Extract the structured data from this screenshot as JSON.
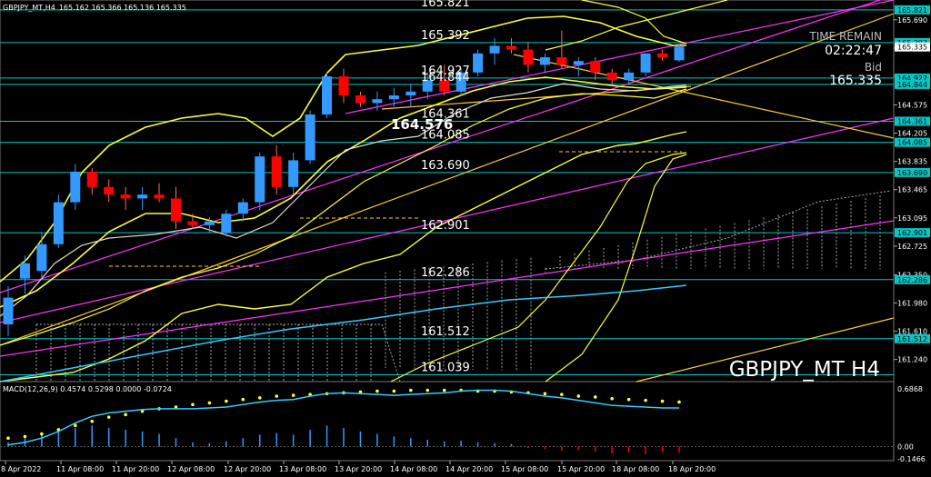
{
  "header": {
    "symbol_info": "GBPJPY_MT,H4",
    "ohlc": "165.162 165.366 165.136 165.335"
  },
  "info_panel": {
    "time_remain_label": "TIME REMAIN",
    "time_remain_value": "02:22:47",
    "bid_label": "Bid",
    "bid_value": "165.335"
  },
  "watermark": "GBPJPY_MT H4",
  "macd_label": "MACD(12,26,9) 0.4574 0.5298 0.0000 -0.0724",
  "price_badge": "164.576",
  "level_labels": [
    {
      "value": "165.821",
      "y": 165.821
    },
    {
      "value": "165.392",
      "y": 165.392
    },
    {
      "value": "164.927",
      "y": 164.927
    },
    {
      "value": "164.844",
      "y": 164.844
    },
    {
      "value": "164.361",
      "y": 164.361
    },
    {
      "value": "164.085",
      "y": 164.085
    },
    {
      "value": "163.690",
      "y": 163.69
    },
    {
      "value": "162.901",
      "y": 162.901
    },
    {
      "value": "162.286",
      "y": 162.286
    },
    {
      "value": "161.512",
      "y": 161.512
    },
    {
      "value": "161.039",
      "y": 161.039
    }
  ],
  "price_axis": {
    "ticks": [
      "165.690",
      "165.320",
      "164.950",
      "164.575",
      "164.205",
      "163.835",
      "163.465",
      "163.095",
      "162.725",
      "162.350",
      "161.980",
      "161.610",
      "161.240"
    ],
    "tick_values": [
      165.69,
      165.32,
      164.95,
      164.575,
      164.205,
      163.835,
      163.465,
      163.095,
      162.725,
      162.35,
      161.98,
      161.61,
      161.24
    ],
    "highlighted": [
      {
        "label": "165.821",
        "v": 165.821
      },
      {
        "label": "165.392",
        "v": 165.392
      },
      {
        "label": "164.927",
        "v": 164.927
      },
      {
        "label": "164.844",
        "v": 164.844
      },
      {
        "label": "164.361",
        "v": 164.361
      },
      {
        "label": "164.085",
        "v": 164.085
      },
      {
        "label": "163.690",
        "v": 163.69
      },
      {
        "label": "162.901",
        "v": 162.901
      },
      {
        "label": "162.286",
        "v": 162.286
      },
      {
        "label": "161.512",
        "v": 161.512
      }
    ],
    "current_price": "165.335",
    "current_value": 165.335
  },
  "macd_axis": {
    "ticks": [
      "0.6868",
      "0.00",
      "-0.1466"
    ],
    "tick_values": [
      0.6868,
      0.0,
      -0.1466
    ]
  },
  "time_axis": [
    "8 Apr 2022",
    "11 Apr 08:00",
    "11 Apr 20:00",
    "12 Apr 08:00",
    "12 Apr 20:00",
    "13 Apr 08:00",
    "13 Apr 20:00",
    "14 Apr 08:00",
    "14 Apr 20:00",
    "15 Apr 08:00",
    "15 Apr 20:00",
    "18 Apr 08:00",
    "18 Apr 20:00"
  ],
  "colors": {
    "bull": "#3399ff",
    "bear": "#ff0000",
    "level_line": "#00c8c8",
    "yellow": "#ffff33",
    "magenta": "#ff33ff",
    "orange": "#ffcc33",
    "cyan": "#33ccff"
  },
  "chart_data": {
    "type": "candlestick",
    "candles": [
      {
        "o": 161.7,
        "h": 162.2,
        "l": 161.55,
        "c": 162.05
      },
      {
        "o": 162.3,
        "h": 162.6,
        "l": 162.1,
        "c": 162.5
      },
      {
        "o": 162.4,
        "h": 162.9,
        "l": 162.3,
        "c": 162.75
      },
      {
        "o": 162.75,
        "h": 163.4,
        "l": 162.7,
        "c": 163.3
      },
      {
        "o": 163.3,
        "h": 163.8,
        "l": 163.2,
        "c": 163.7
      },
      {
        "o": 163.7,
        "h": 163.75,
        "l": 163.4,
        "c": 163.5
      },
      {
        "o": 163.5,
        "h": 163.6,
        "l": 163.3,
        "c": 163.4
      },
      {
        "o": 163.4,
        "h": 163.5,
        "l": 163.2,
        "c": 163.35
      },
      {
        "o": 163.35,
        "h": 163.5,
        "l": 163.2,
        "c": 163.4
      },
      {
        "o": 163.4,
        "h": 163.55,
        "l": 163.3,
        "c": 163.35
      },
      {
        "o": 163.35,
        "h": 163.5,
        "l": 162.95,
        "c": 163.05
      },
      {
        "o": 163.05,
        "h": 163.15,
        "l": 162.95,
        "c": 163.0
      },
      {
        "o": 163.0,
        "h": 163.1,
        "l": 162.9,
        "c": 163.05
      },
      {
        "o": 162.9,
        "h": 163.2,
        "l": 162.85,
        "c": 163.15
      },
      {
        "o": 163.15,
        "h": 163.35,
        "l": 163.05,
        "c": 163.3
      },
      {
        "o": 163.3,
        "h": 163.95,
        "l": 163.2,
        "c": 163.9
      },
      {
        "o": 163.9,
        "h": 164.05,
        "l": 163.4,
        "c": 163.5
      },
      {
        "o": 163.5,
        "h": 163.95,
        "l": 163.4,
        "c": 163.85
      },
      {
        "o": 163.85,
        "h": 164.5,
        "l": 163.8,
        "c": 164.45
      },
      {
        "o": 164.45,
        "h": 165.0,
        "l": 164.4,
        "c": 164.95
      },
      {
        "o": 164.95,
        "h": 165.05,
        "l": 164.6,
        "c": 164.7
      },
      {
        "o": 164.7,
        "h": 164.75,
        "l": 164.55,
        "c": 164.6
      },
      {
        "o": 164.6,
        "h": 164.75,
        "l": 164.5,
        "c": 164.65
      },
      {
        "o": 164.65,
        "h": 164.8,
        "l": 164.55,
        "c": 164.7
      },
      {
        "o": 164.7,
        "h": 164.85,
        "l": 164.55,
        "c": 164.75
      },
      {
        "o": 164.75,
        "h": 165.0,
        "l": 164.65,
        "c": 164.9
      },
      {
        "o": 164.9,
        "h": 165.1,
        "l": 164.7,
        "c": 164.75
      },
      {
        "o": 164.75,
        "h": 165.05,
        "l": 164.7,
        "c": 165.0
      },
      {
        "o": 165.0,
        "h": 165.3,
        "l": 164.95,
        "c": 165.25
      },
      {
        "o": 165.25,
        "h": 165.45,
        "l": 165.1,
        "c": 165.35
      },
      {
        "o": 165.35,
        "h": 165.45,
        "l": 165.25,
        "c": 165.3
      },
      {
        "o": 165.3,
        "h": 165.4,
        "l": 165.0,
        "c": 165.1
      },
      {
        "o": 165.1,
        "h": 165.25,
        "l": 165.0,
        "c": 165.2
      },
      {
        "o": 165.2,
        "h": 165.55,
        "l": 165.05,
        "c": 165.1
      },
      {
        "o": 165.1,
        "h": 165.2,
        "l": 164.95,
        "c": 165.15
      },
      {
        "o": 165.15,
        "h": 165.2,
        "l": 164.9,
        "c": 165.0
      },
      {
        "o": 165.0,
        "h": 165.05,
        "l": 164.85,
        "c": 164.9
      },
      {
        "o": 164.9,
        "h": 165.05,
        "l": 164.85,
        "c": 165.0
      },
      {
        "o": 165.0,
        "h": 165.25,
        "l": 164.95,
        "c": 165.25
      },
      {
        "o": 165.25,
        "h": 165.3,
        "l": 165.15,
        "c": 165.2
      },
      {
        "o": 165.16,
        "h": 165.37,
        "l": 165.14,
        "c": 165.34
      }
    ]
  }
}
